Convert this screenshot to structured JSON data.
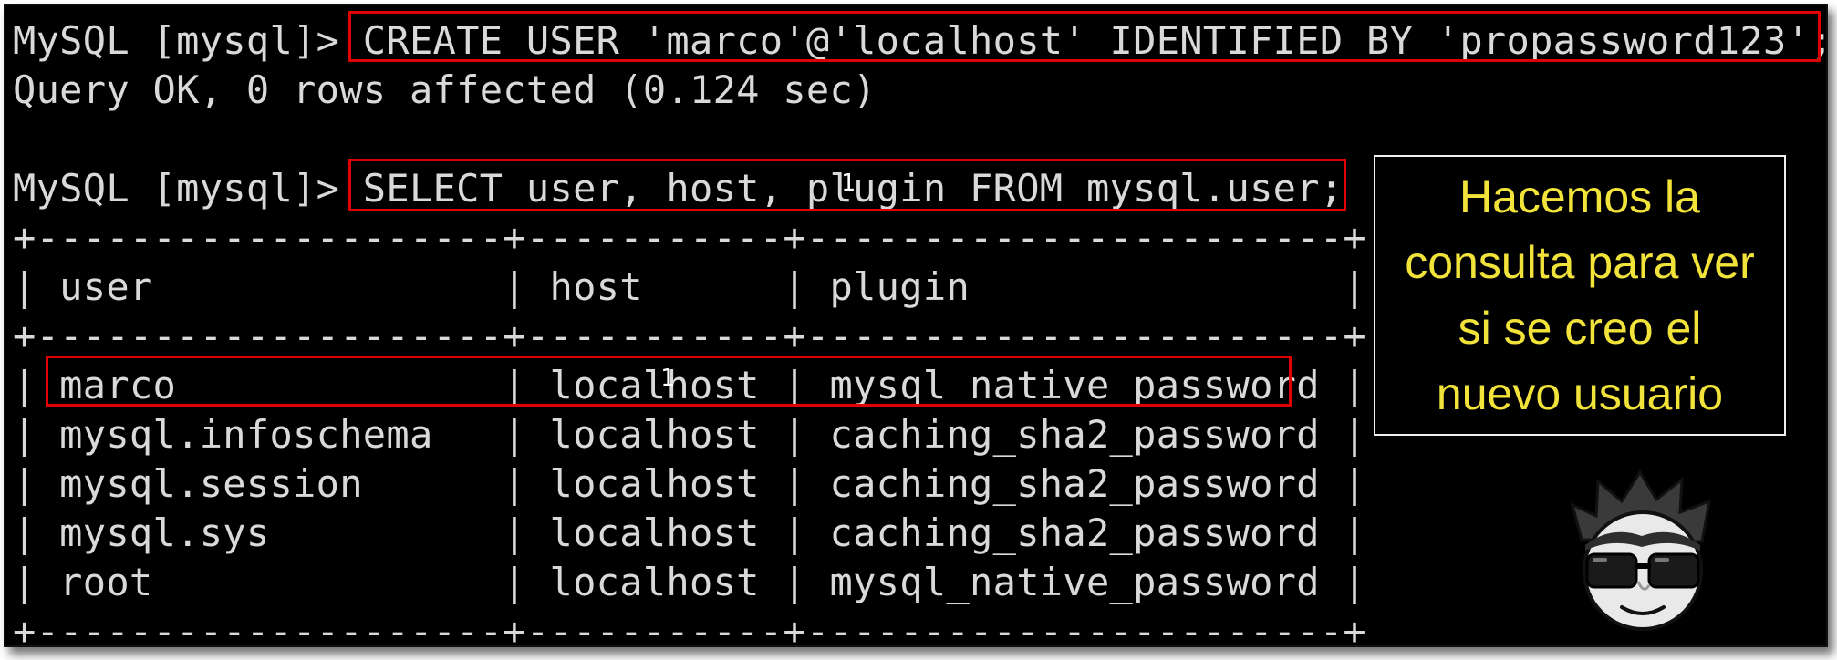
{
  "terminal": {
    "lines": [
      "MySQL [mysql]> CREATE USER 'marco'@'localhost' IDENTIFIED BY 'propassword123';",
      "Query OK, 0 rows affected (0.124 sec)",
      "MySQL [mysql]> SELECT user, host, plugin FROM mysql.user;",
      "+--------------------+-----------+-----------------------+",
      "| user               | host      | plugin                |",
      "+--------------------+-----------+-----------------------+",
      "| marco              | localhost | mysql_native_password |",
      "| mysql.infoschema   | localhost | caching_sha2_password |",
      "| mysql.session      | localhost | caching_sha2_password |",
      "| mysql.sys          | localhost | caching_sha2_password |",
      "| root               | localhost | mysql_native_password |",
      "+--------------------+-----------+-----------------------+"
    ],
    "cursor_marks": [
      "1",
      "1"
    ]
  },
  "callout": {
    "text": "Hacemos la\nconsulta para ver\nsi se creo  el\nnuevo usuario"
  },
  "colors": {
    "terminal_bg": "#000000",
    "terminal_text": "#d9d9d9",
    "highlight": "#e00000",
    "callout_text": "#f2e33a"
  },
  "icons": {
    "avatar": "cartoon-face-with-sunglasses-icon"
  }
}
